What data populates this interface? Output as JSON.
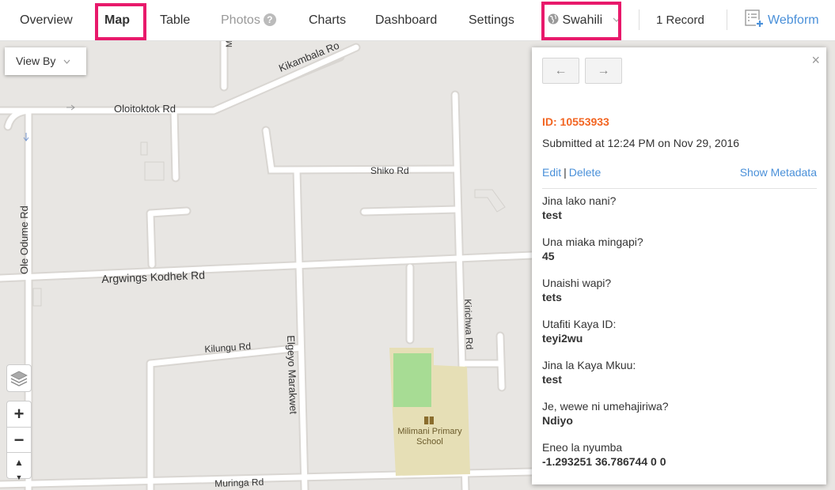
{
  "nav": {
    "overview": "Overview",
    "map": "Map",
    "table": "Table",
    "photos": "Photos",
    "photos_help": "?",
    "charts": "Charts",
    "dashboard": "Dashboard",
    "settings": "Settings",
    "language": "Swahili",
    "record_count": "1 Record",
    "webform": "Webform"
  },
  "map": {
    "view_by": "View By",
    "zoom_in": "+",
    "zoom_out": "−",
    "compass": "▲",
    "roads": {
      "mazeras": "Maze",
      "kikambala": "Kikambala Ro",
      "oloitoktok": "Oloitoktok Rd",
      "shiko": "Shiko Rd",
      "ole_odume": "Ole Odume Rd",
      "argwings": "Argwings Kodhek Rd",
      "kilungu": "Kilungu Rd",
      "elgeyo": "Elgeyo Marakwet",
      "kirichwa": "Kirichwa Rd",
      "muringa": "Muringa Rd"
    },
    "school_line1": "Milimani Primary",
    "school_line2": "School"
  },
  "record": {
    "id_label": "ID: 10553933",
    "submitted": "Submitted at 12:24 PM on Nov 29, 2016",
    "edit": "Edit",
    "separator": "|",
    "delete": "Delete",
    "show_metadata": "Show Metadata",
    "prev_arrow": "←",
    "next_arrow": "→",
    "close": "×",
    "fields": [
      {
        "label": "Jina lako nani?",
        "value": "test"
      },
      {
        "label": "Una miaka mingapi?",
        "value": "45"
      },
      {
        "label": "Unaishi wapi?",
        "value": "tets"
      },
      {
        "label": "Utafiti Kaya ID:",
        "value": "teyi2wu"
      },
      {
        "label": "Jina la Kaya Mkuu:",
        "value": "test"
      },
      {
        "label": "Je, wewe ni umehajiriwa?",
        "value": "Ndiyo"
      },
      {
        "label": "Eneo la nyumba",
        "value": "-1.293251 36.786744 0 0"
      }
    ]
  },
  "colors": {
    "accent": "#4a90d9",
    "highlight": "#e8196b",
    "id": "#f26522"
  }
}
